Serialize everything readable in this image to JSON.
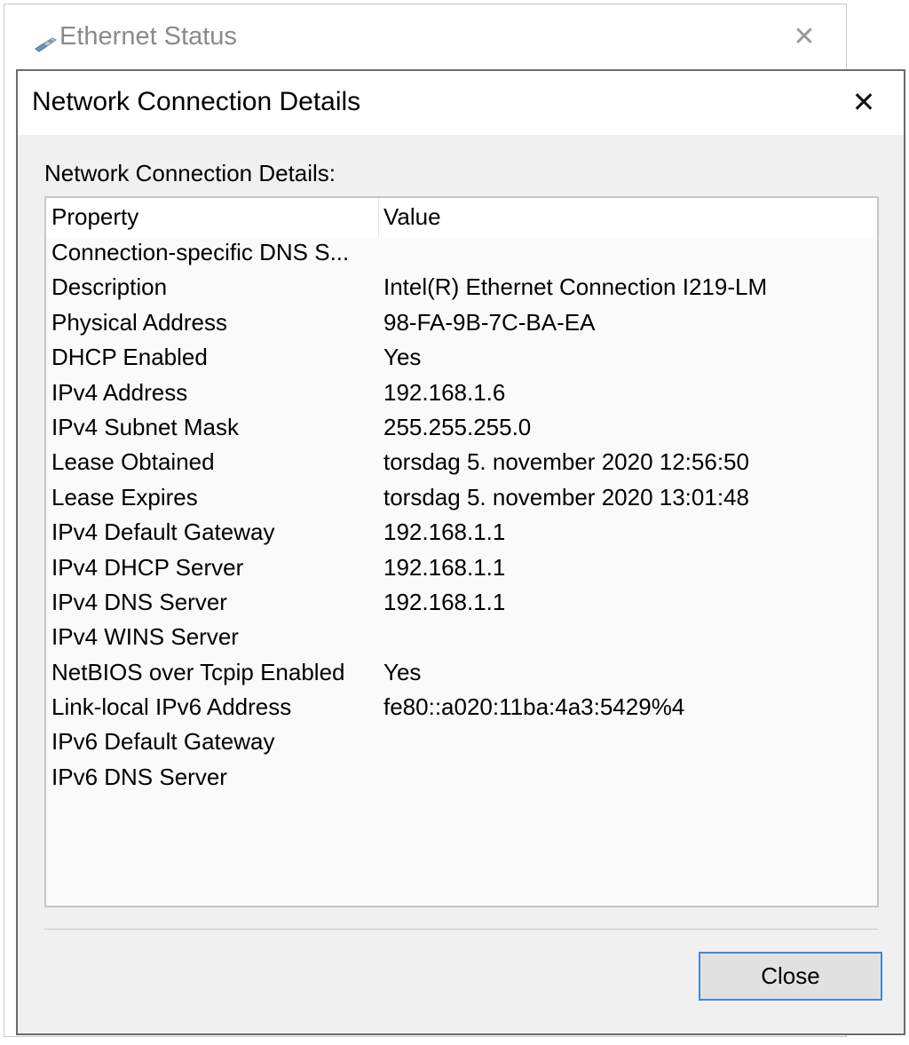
{
  "background_window": {
    "title": "Ethernet Status",
    "icon": "network-adapter-icon",
    "close_glyph": "✕"
  },
  "dialog": {
    "title": "Network Connection Details",
    "close_glyph": "✕",
    "group_label": "Network Connection Details:",
    "columns": {
      "property": "Property",
      "value": "Value"
    },
    "rows": [
      {
        "property": "Connection-specific DNS S...",
        "value": ""
      },
      {
        "property": "Description",
        "value": "Intel(R) Ethernet Connection I219-LM"
      },
      {
        "property": "Physical Address",
        "value": "98-FA-9B-7C-BA-EA"
      },
      {
        "property": "DHCP Enabled",
        "value": "Yes"
      },
      {
        "property": "IPv4 Address",
        "value": "192.168.1.6"
      },
      {
        "property": "IPv4 Subnet Mask",
        "value": "255.255.255.0"
      },
      {
        "property": "Lease Obtained",
        "value": "torsdag 5. november 2020 12:56:50"
      },
      {
        "property": "Lease Expires",
        "value": "torsdag 5. november 2020 13:01:48"
      },
      {
        "property": "IPv4 Default Gateway",
        "value": "192.168.1.1"
      },
      {
        "property": "IPv4 DHCP Server",
        "value": "192.168.1.1"
      },
      {
        "property": "IPv4 DNS Server",
        "value": "192.168.1.1"
      },
      {
        "property": "IPv4 WINS Server",
        "value": ""
      },
      {
        "property": "NetBIOS over Tcpip Enabled",
        "value": "Yes"
      },
      {
        "property": "Link-local IPv6 Address",
        "value": "fe80::a020:11ba:4a3:5429%4"
      },
      {
        "property": "IPv6 Default Gateway",
        "value": ""
      },
      {
        "property": "IPv6 DNS Server",
        "value": ""
      }
    ],
    "close_button_label": "Close"
  },
  "colors": {
    "dialog_background": "#f0f0f0",
    "button_focus_border": "#3c8ad8"
  }
}
